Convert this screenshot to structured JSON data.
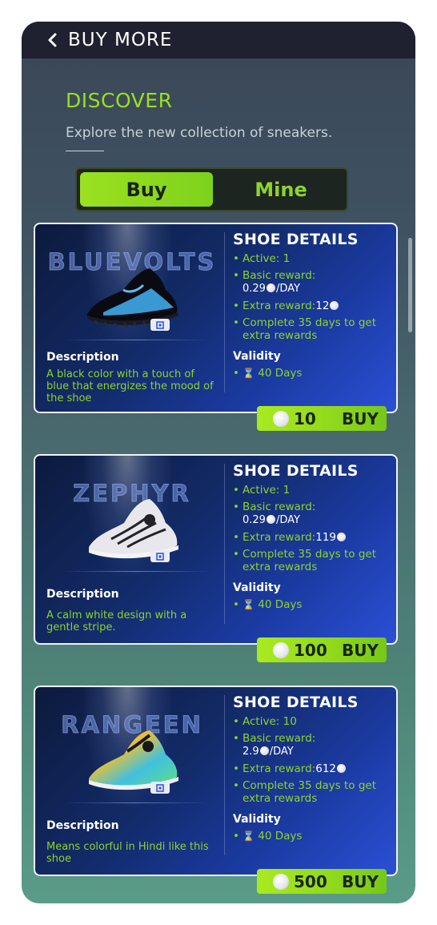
{
  "header": {
    "title": "BUY MORE"
  },
  "intro": {
    "heading": "DISCOVER",
    "subtitle": "Explore the new collection of sneakers."
  },
  "toggle": {
    "buy_label": "Buy",
    "mine_label": "Mine",
    "selected": "Buy"
  },
  "shoes": [
    {
      "brand": "BLUEVOLTS",
      "description_title": "Description",
      "description": "A black color with a touch of blue that energizes the mood of the shoe",
      "details_title": "SHOE DETAILS",
      "active": "Active: 1",
      "basic_reward_label": "Basic reward:",
      "basic_reward_value": "0.29",
      "basic_reward_unit": "/DAY",
      "extra_reward_label": "Extra reward:",
      "extra_reward_value": "12",
      "complete_text": "Complete 35 days to get extra rewards",
      "validity_title": "Validity",
      "validity_value": "40 Days",
      "price": "10",
      "buy_label": "BUY",
      "colors": [
        "#0a0a10",
        "#3fa8e8"
      ]
    },
    {
      "brand": "ZEPHYR",
      "description_title": "Description",
      "description": "A calm white design with a gentle stripe.",
      "details_title": "SHOE DETAILS",
      "active": "Active: 1",
      "basic_reward_label": "Basic reward:",
      "basic_reward_value": "0.29",
      "basic_reward_unit": "/DAY",
      "extra_reward_label": "Extra reward:",
      "extra_reward_value": "119",
      "complete_text": "Complete 35 days to get extra rewards",
      "validity_title": "Validity",
      "validity_value": "40 Days",
      "price": "100",
      "buy_label": "BUY",
      "colors": [
        "#e8e8ec",
        "#222228"
      ]
    },
    {
      "brand": "RANGEEN",
      "description_title": "Description",
      "description": "Means colorful in Hindi like this shoe",
      "details_title": "SHOE DETAILS",
      "active": "Active: 10",
      "basic_reward_label": "Basic reward:",
      "basic_reward_value": "2.9",
      "basic_reward_unit": "/DAY",
      "extra_reward_label": "Extra reward:",
      "extra_reward_value": "612",
      "complete_text": "Complete 35 days to get extra rewards",
      "validity_title": "Validity",
      "validity_value": "40 Days",
      "price": "500",
      "buy_label": "BUY",
      "colors": [
        "#e0407a",
        "#40c0e0",
        "#f0c030"
      ]
    }
  ],
  "colors": {
    "accent_green": "#8fd42a",
    "topbar": "#1f2030",
    "card_blue": "#1a3aa0"
  }
}
